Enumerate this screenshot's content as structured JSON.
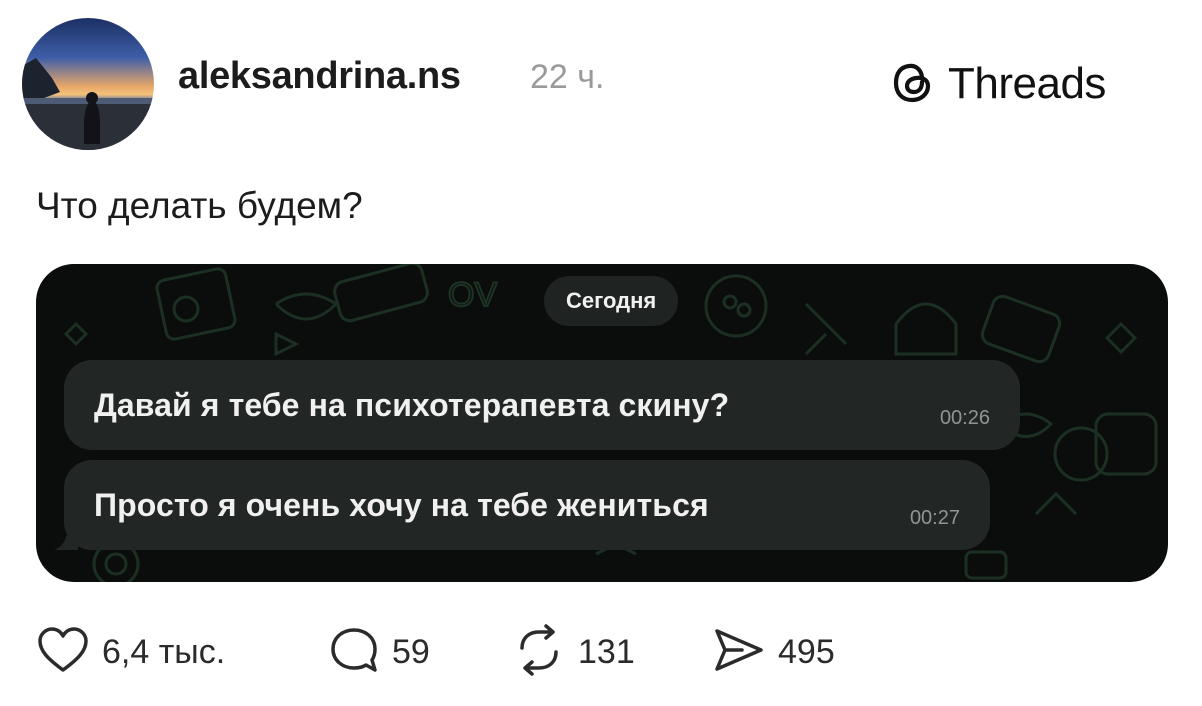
{
  "post": {
    "author": "aleksandrina.ns",
    "time_ago": "22 ч.",
    "text": "Что делать будем?"
  },
  "brand": {
    "icon": "threads-logo-icon",
    "label": "Threads"
  },
  "chat": {
    "date_label": "Сегодня",
    "messages": [
      {
        "text": "Давай я тебе на психотерапевта скину?",
        "time": "00:26"
      },
      {
        "text": "Просто я очень хочу на тебе жениться",
        "time": "00:27"
      }
    ]
  },
  "actions": {
    "likes": {
      "icon": "heart-icon",
      "count": "6,4 тыс."
    },
    "replies": {
      "icon": "comment-icon",
      "count": "59"
    },
    "reposts": {
      "icon": "repost-icon",
      "count": "131"
    },
    "shares": {
      "icon": "send-icon",
      "count": "495"
    }
  },
  "colors": {
    "chat_background": "#0b0d0c",
    "bubble": "#222624",
    "pattern_line": "#1b2f22",
    "meta_gray": "#9a9a9a"
  }
}
